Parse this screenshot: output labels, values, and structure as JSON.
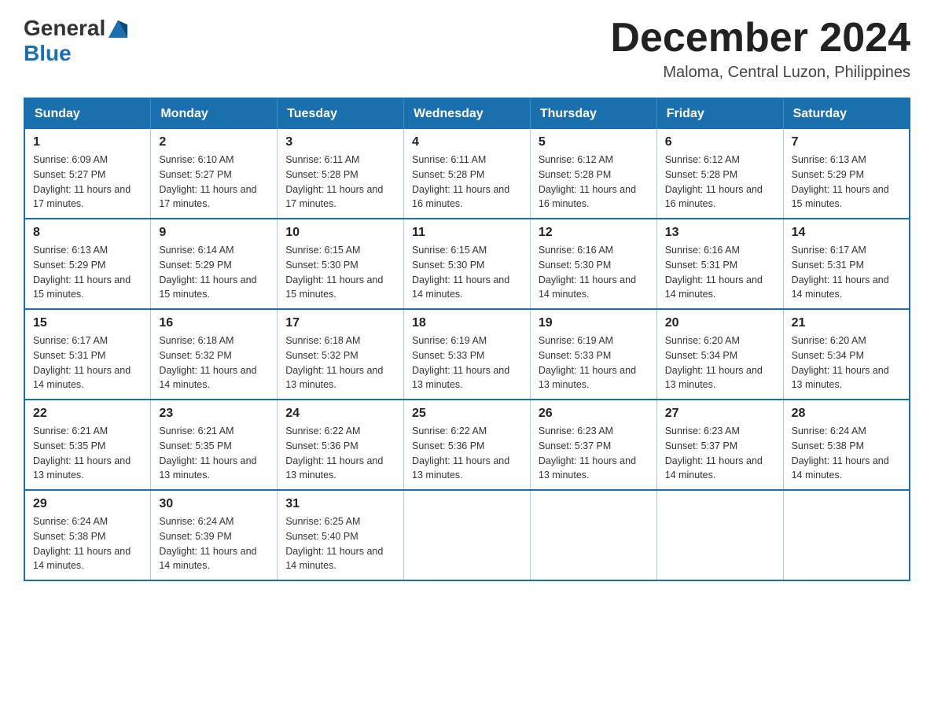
{
  "header": {
    "logo": {
      "general": "General",
      "blue": "Blue",
      "tagline": ""
    },
    "title": "December 2024",
    "subtitle": "Maloma, Central Luzon, Philippines"
  },
  "calendar": {
    "days_of_week": [
      "Sunday",
      "Monday",
      "Tuesday",
      "Wednesday",
      "Thursday",
      "Friday",
      "Saturday"
    ],
    "weeks": [
      [
        {
          "day": "1",
          "sunrise": "Sunrise: 6:09 AM",
          "sunset": "Sunset: 5:27 PM",
          "daylight": "Daylight: 11 hours and 17 minutes."
        },
        {
          "day": "2",
          "sunrise": "Sunrise: 6:10 AM",
          "sunset": "Sunset: 5:27 PM",
          "daylight": "Daylight: 11 hours and 17 minutes."
        },
        {
          "day": "3",
          "sunrise": "Sunrise: 6:11 AM",
          "sunset": "Sunset: 5:28 PM",
          "daylight": "Daylight: 11 hours and 17 minutes."
        },
        {
          "day": "4",
          "sunrise": "Sunrise: 6:11 AM",
          "sunset": "Sunset: 5:28 PM",
          "daylight": "Daylight: 11 hours and 16 minutes."
        },
        {
          "day": "5",
          "sunrise": "Sunrise: 6:12 AM",
          "sunset": "Sunset: 5:28 PM",
          "daylight": "Daylight: 11 hours and 16 minutes."
        },
        {
          "day": "6",
          "sunrise": "Sunrise: 6:12 AM",
          "sunset": "Sunset: 5:28 PM",
          "daylight": "Daylight: 11 hours and 16 minutes."
        },
        {
          "day": "7",
          "sunrise": "Sunrise: 6:13 AM",
          "sunset": "Sunset: 5:29 PM",
          "daylight": "Daylight: 11 hours and 15 minutes."
        }
      ],
      [
        {
          "day": "8",
          "sunrise": "Sunrise: 6:13 AM",
          "sunset": "Sunset: 5:29 PM",
          "daylight": "Daylight: 11 hours and 15 minutes."
        },
        {
          "day": "9",
          "sunrise": "Sunrise: 6:14 AM",
          "sunset": "Sunset: 5:29 PM",
          "daylight": "Daylight: 11 hours and 15 minutes."
        },
        {
          "day": "10",
          "sunrise": "Sunrise: 6:15 AM",
          "sunset": "Sunset: 5:30 PM",
          "daylight": "Daylight: 11 hours and 15 minutes."
        },
        {
          "day": "11",
          "sunrise": "Sunrise: 6:15 AM",
          "sunset": "Sunset: 5:30 PM",
          "daylight": "Daylight: 11 hours and 14 minutes."
        },
        {
          "day": "12",
          "sunrise": "Sunrise: 6:16 AM",
          "sunset": "Sunset: 5:30 PM",
          "daylight": "Daylight: 11 hours and 14 minutes."
        },
        {
          "day": "13",
          "sunrise": "Sunrise: 6:16 AM",
          "sunset": "Sunset: 5:31 PM",
          "daylight": "Daylight: 11 hours and 14 minutes."
        },
        {
          "day": "14",
          "sunrise": "Sunrise: 6:17 AM",
          "sunset": "Sunset: 5:31 PM",
          "daylight": "Daylight: 11 hours and 14 minutes."
        }
      ],
      [
        {
          "day": "15",
          "sunrise": "Sunrise: 6:17 AM",
          "sunset": "Sunset: 5:31 PM",
          "daylight": "Daylight: 11 hours and 14 minutes."
        },
        {
          "day": "16",
          "sunrise": "Sunrise: 6:18 AM",
          "sunset": "Sunset: 5:32 PM",
          "daylight": "Daylight: 11 hours and 14 minutes."
        },
        {
          "day": "17",
          "sunrise": "Sunrise: 6:18 AM",
          "sunset": "Sunset: 5:32 PM",
          "daylight": "Daylight: 11 hours and 13 minutes."
        },
        {
          "day": "18",
          "sunrise": "Sunrise: 6:19 AM",
          "sunset": "Sunset: 5:33 PM",
          "daylight": "Daylight: 11 hours and 13 minutes."
        },
        {
          "day": "19",
          "sunrise": "Sunrise: 6:19 AM",
          "sunset": "Sunset: 5:33 PM",
          "daylight": "Daylight: 11 hours and 13 minutes."
        },
        {
          "day": "20",
          "sunrise": "Sunrise: 6:20 AM",
          "sunset": "Sunset: 5:34 PM",
          "daylight": "Daylight: 11 hours and 13 minutes."
        },
        {
          "day": "21",
          "sunrise": "Sunrise: 6:20 AM",
          "sunset": "Sunset: 5:34 PM",
          "daylight": "Daylight: 11 hours and 13 minutes."
        }
      ],
      [
        {
          "day": "22",
          "sunrise": "Sunrise: 6:21 AM",
          "sunset": "Sunset: 5:35 PM",
          "daylight": "Daylight: 11 hours and 13 minutes."
        },
        {
          "day": "23",
          "sunrise": "Sunrise: 6:21 AM",
          "sunset": "Sunset: 5:35 PM",
          "daylight": "Daylight: 11 hours and 13 minutes."
        },
        {
          "day": "24",
          "sunrise": "Sunrise: 6:22 AM",
          "sunset": "Sunset: 5:36 PM",
          "daylight": "Daylight: 11 hours and 13 minutes."
        },
        {
          "day": "25",
          "sunrise": "Sunrise: 6:22 AM",
          "sunset": "Sunset: 5:36 PM",
          "daylight": "Daylight: 11 hours and 13 minutes."
        },
        {
          "day": "26",
          "sunrise": "Sunrise: 6:23 AM",
          "sunset": "Sunset: 5:37 PM",
          "daylight": "Daylight: 11 hours and 13 minutes."
        },
        {
          "day": "27",
          "sunrise": "Sunrise: 6:23 AM",
          "sunset": "Sunset: 5:37 PM",
          "daylight": "Daylight: 11 hours and 14 minutes."
        },
        {
          "day": "28",
          "sunrise": "Sunrise: 6:24 AM",
          "sunset": "Sunset: 5:38 PM",
          "daylight": "Daylight: 11 hours and 14 minutes."
        }
      ],
      [
        {
          "day": "29",
          "sunrise": "Sunrise: 6:24 AM",
          "sunset": "Sunset: 5:38 PM",
          "daylight": "Daylight: 11 hours and 14 minutes."
        },
        {
          "day": "30",
          "sunrise": "Sunrise: 6:24 AM",
          "sunset": "Sunset: 5:39 PM",
          "daylight": "Daylight: 11 hours and 14 minutes."
        },
        {
          "day": "31",
          "sunrise": "Sunrise: 6:25 AM",
          "sunset": "Sunset: 5:40 PM",
          "daylight": "Daylight: 11 hours and 14 minutes."
        },
        null,
        null,
        null,
        null
      ]
    ]
  }
}
